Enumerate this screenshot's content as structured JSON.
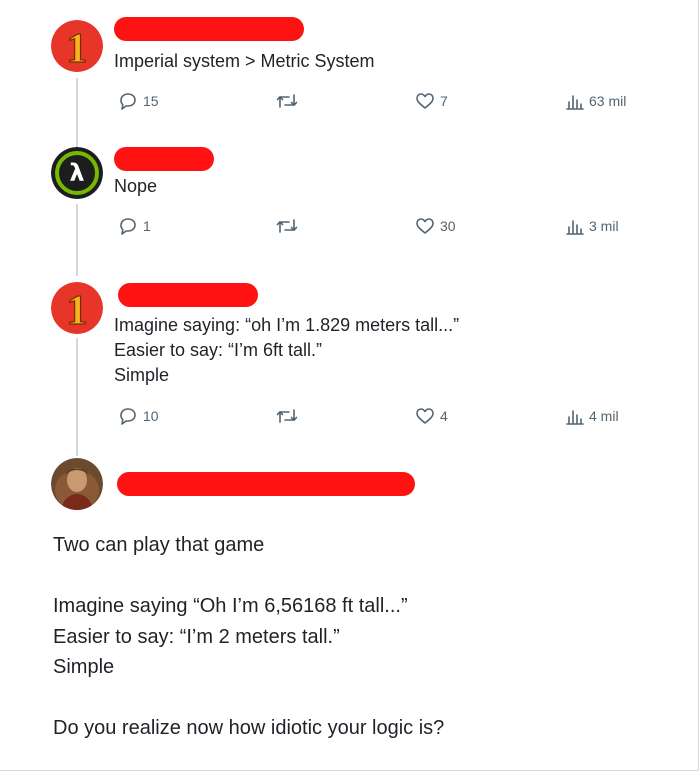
{
  "tweets": [
    {
      "text": "Imperial system > Metric System",
      "replies": "15",
      "likes": "7",
      "views": "63 mil"
    },
    {
      "text": "Nope",
      "replies": "1",
      "likes": "30",
      "views": "3 mil"
    },
    {
      "text": "Imagine saying: “oh I’m 1.829 meters tall...”\nEasier to say: “I’m 6ft tall.”\nSimple",
      "replies": "10",
      "likes": "4",
      "views": "4 mil"
    }
  ],
  "final_post": {
    "text": "Two can play that game\n\nImagine saying “Oh I’m 6,56168 ft tall...”\nEasier to say: “I’m 2 meters tall.”\nSimple\n\nDo you realize now how idiotic your logic is?"
  },
  "avatars": {
    "first": "1",
    "second": "λ"
  },
  "colors": {
    "redaction": "#ff1212",
    "icon_gray": "#536471",
    "avatar_red": "#e8352a",
    "avatar_gold": "#f5b321"
  },
  "icons": [
    "reply-icon",
    "retweet-icon",
    "like-icon",
    "views-icon"
  ]
}
